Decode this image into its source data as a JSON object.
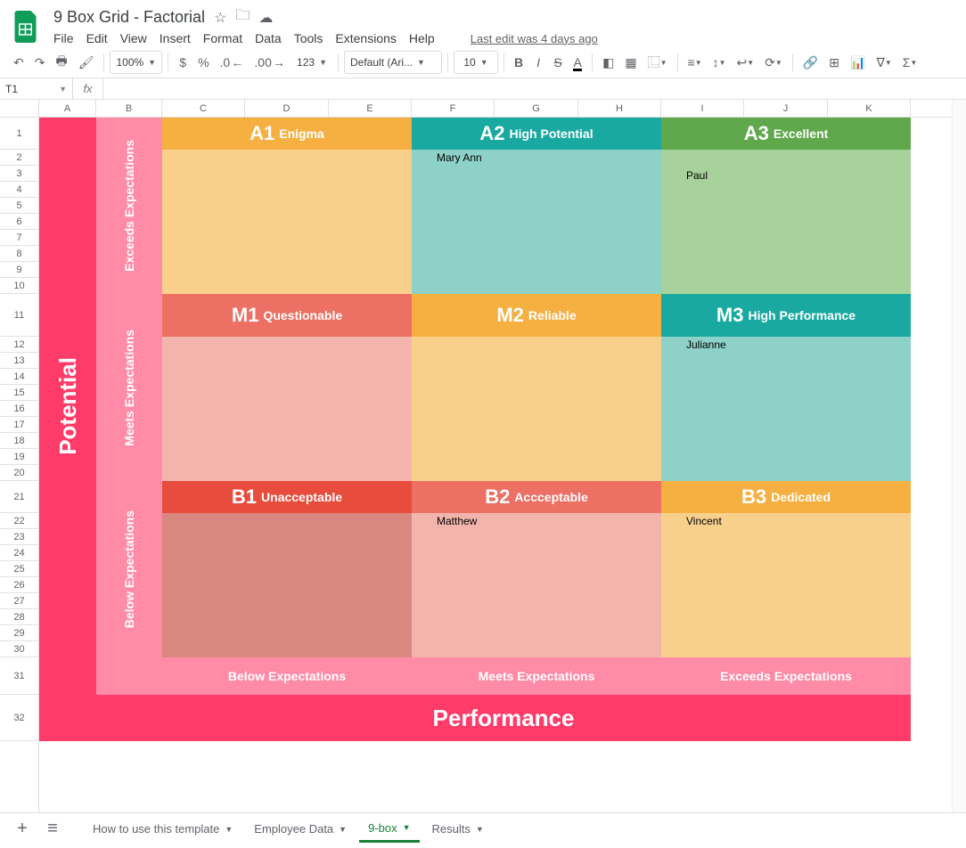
{
  "header": {
    "title": "9 Box Grid - Factorial",
    "last_edit": "Last edit was 4 days ago"
  },
  "menus": [
    "File",
    "Edit",
    "View",
    "Insert",
    "Format",
    "Data",
    "Tools",
    "Extensions",
    "Help"
  ],
  "toolbar": {
    "zoom": "100%",
    "font": "Default (Ari...",
    "fontsize": "10",
    "moneyfmt": "123"
  },
  "namebox": "T1",
  "columns": [
    "A",
    "B",
    "C",
    "D",
    "E",
    "F",
    "G",
    "H",
    "I",
    "J",
    "K"
  ],
  "row_nums": [
    "1",
    "2",
    "3",
    "4",
    "5",
    "6",
    "7",
    "8",
    "9",
    "10",
    "11",
    "12",
    "13",
    "14",
    "15",
    "16",
    "17",
    "18",
    "19",
    "20",
    "21",
    "22",
    "23",
    "24",
    "25",
    "26",
    "27",
    "28",
    "29",
    "30",
    "31",
    "32"
  ],
  "axes": {
    "potential": "Potential",
    "performance": "Performance",
    "yA": "Exceeds Expectations",
    "yM": "Meets Expectations",
    "yB": "Below Expectations",
    "x1": "Below Expectations",
    "x2": "Meets Expectations",
    "x3": "Exceeds Expectations"
  },
  "boxes": {
    "A1": {
      "code": "A1",
      "label": "Enigma",
      "content": ""
    },
    "A2": {
      "code": "A2",
      "label": "High Potential",
      "content": "Mary Ann"
    },
    "A3": {
      "code": "A3",
      "label": "Excellent",
      "content": "Paul"
    },
    "M1": {
      "code": "M1",
      "label": "Questionable",
      "content": ""
    },
    "M2": {
      "code": "M2",
      "label": "Reliable",
      "content": ""
    },
    "M3": {
      "code": "M3",
      "label": "High Performance",
      "content": "Julianne"
    },
    "B1": {
      "code": "B1",
      "label": "Unacceptable",
      "content": ""
    },
    "B2": {
      "code": "B2",
      "label": "Accceptable",
      "content": "Matthew"
    },
    "B3": {
      "code": "B3",
      "label": "Dedicated",
      "content": "Vincent"
    }
  },
  "colors": {
    "A1_h": "#f5b041",
    "A1_b": "#f8d08c",
    "A2_h": "#1aa9a0",
    "A2_b": "#8dd1c8",
    "A3_h": "#5fa84c",
    "A3_b": "#a8d29b",
    "M1_h": "#ec7063",
    "M1_b": "#f3b4ad",
    "M2_h": "#f5b041",
    "M2_b": "#f8d08c",
    "M3_h": "#1aa9a0",
    "M3_b": "#8dd1c8",
    "B1_h": "#e74c3c",
    "B1_b": "#d98880",
    "B2_h": "#ec7063",
    "B2_b": "#f3b4ad",
    "B3_h": "#f5b041",
    "B3_b": "#f8d08c"
  },
  "tabs": [
    "How to use this template",
    "Employee Data",
    "9-box",
    "Results"
  ],
  "active_tab": 2
}
